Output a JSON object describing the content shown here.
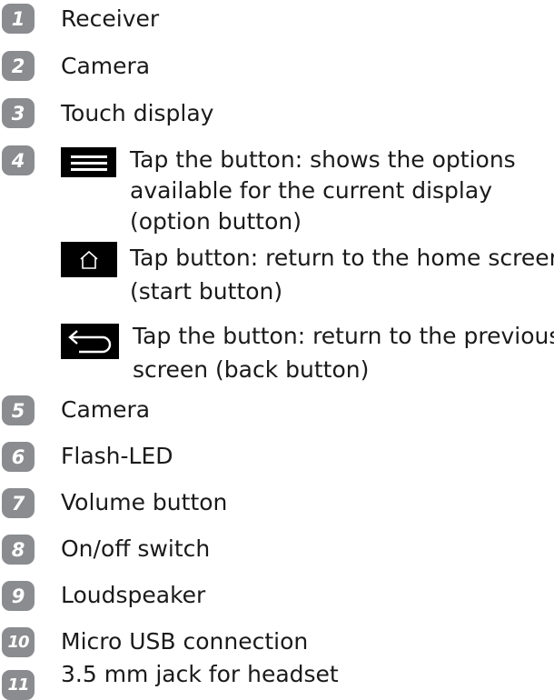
{
  "items": [
    {
      "num": "1",
      "text": "Receiver"
    },
    {
      "num": "2",
      "text": "Camera"
    },
    {
      "num": "3",
      "text": "Touch display"
    },
    {
      "num": "4"
    },
    {
      "num": "5",
      "text": "Camera"
    },
    {
      "num": "6",
      "text": "Flash-LED"
    },
    {
      "num": "7",
      "text": "Volume button"
    },
    {
      "num": "8",
      "text": "On/off switch"
    },
    {
      "num": "9",
      "text": "Loudspeaker"
    },
    {
      "num": "10",
      "text": "Micro USB connection"
    },
    {
      "num": "11",
      "text": "3.5 mm jack for headset"
    }
  ],
  "buttons": [
    {
      "icon": "menu-icon",
      "lines": [
        "Tap the button: shows the options",
        "available for the current display",
        "(option button)"
      ]
    },
    {
      "icon": "home-icon",
      "lines": [
        "Tap button: return to the home screen",
        "(start button)"
      ]
    },
    {
      "icon": "back-arrow-icon",
      "lines": [
        "Tap the button: return to the previous",
        "screen (back button)"
      ]
    }
  ]
}
